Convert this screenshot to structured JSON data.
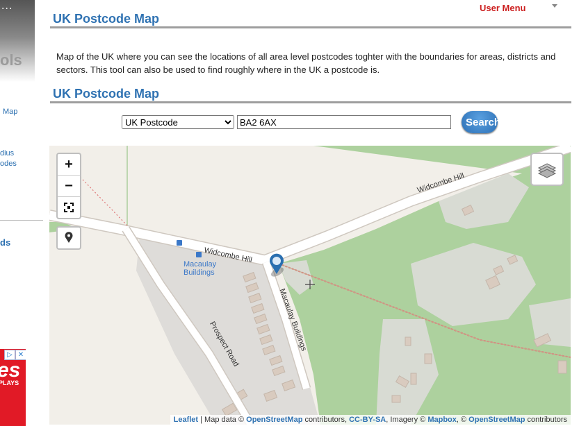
{
  "sidebar": {
    "logo_dots": "...",
    "logo_tail": "ols",
    "links": [
      "Map",
      "dius",
      "odes"
    ],
    "heading": "ds",
    "ad": {
      "big_text": "es",
      "small_text": "PLAYS",
      "play_icon": "play-icon",
      "close_icon": "close-icon"
    }
  },
  "header": {
    "user_menu": "User Menu",
    "title": "UK Postcode Map",
    "description": "Map of the UK where you can see the locations of all area level postcodes toghter with the boundaries for areas, districts and sectors. This tool can also be used to find roughly where in the UK a postcode is.",
    "section_title": "UK Postcode Map"
  },
  "search": {
    "type_selected": "UK Postcode",
    "query": "BA2 6AX",
    "button_label": "Search"
  },
  "map": {
    "zoom_in": "+",
    "zoom_out": "−",
    "labels": {
      "road_top": "Widcombe Hill",
      "road_mid": "Widcombe Hill",
      "place": "Macaulay Buildings",
      "road_macaulay": "Macaulay Buildings",
      "road_prospect": "Prospect Road"
    },
    "attribution": {
      "leaflet": "Leaflet",
      "sep1": " | Map data © ",
      "osm": "OpenStreetMap",
      "sep2": " contributors, ",
      "license": "CC-BY-SA",
      "sep3": ", Imagery © ",
      "mapbox": "Mapbox",
      "sep4": ", © ",
      "osm2": "OpenStreetMap",
      "sep5": " contributors"
    },
    "colors": {
      "land": "#f2efe9",
      "wood": "#add19e",
      "building": "#d9d0c9",
      "road": "#ffffff",
      "marker": "#2a6fb0"
    }
  }
}
